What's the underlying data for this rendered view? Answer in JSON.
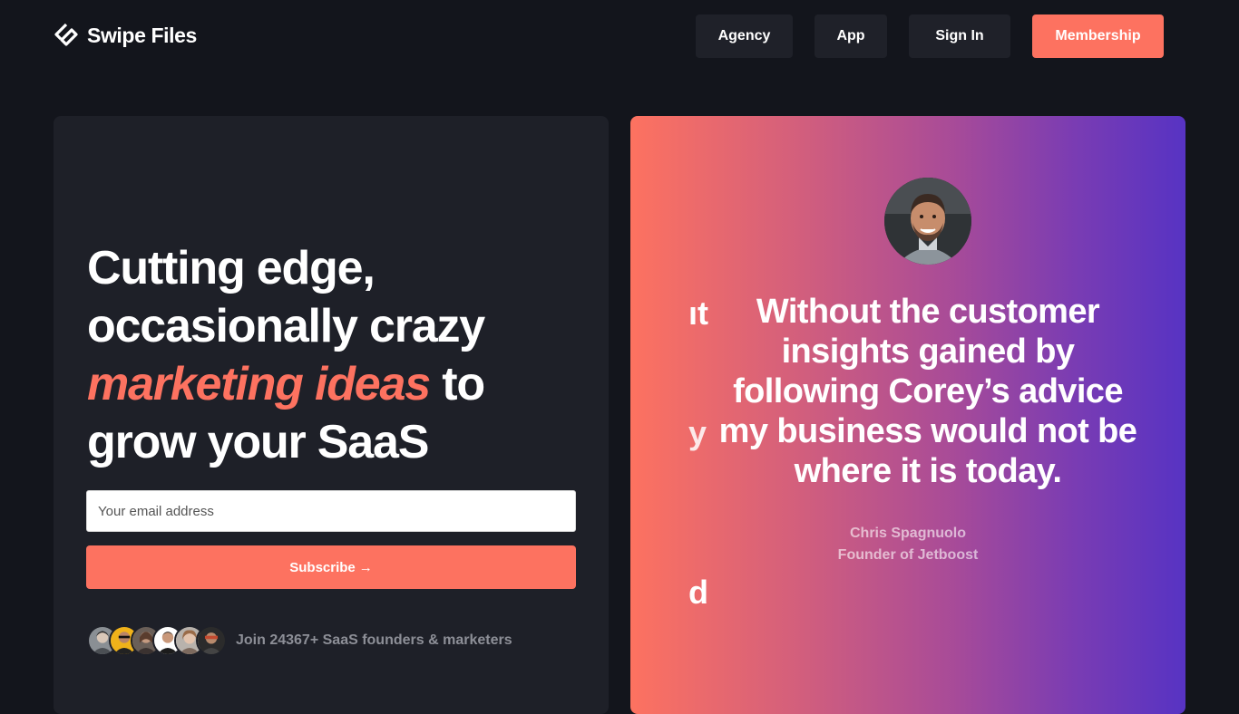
{
  "brand": {
    "name": "Swipe Files",
    "logo_icon": "swipe-files-logo-icon",
    "accent_color": "#fd7260"
  },
  "nav": {
    "items": [
      {
        "label": "Agency"
      },
      {
        "label": "App"
      },
      {
        "label": "Sign In"
      },
      {
        "label": "Membership"
      }
    ]
  },
  "hero": {
    "headline_line1": "Cutting edge,",
    "headline_line2": "occasionally crazy",
    "headline_accent": "marketing ideas",
    "headline_after_accent": " to",
    "headline_line4": "grow your SaaS",
    "email_placeholder": "Your email address",
    "subscribe_label": "Subscribe",
    "subscribe_icon": "arrow-right-icon",
    "subscribe_arrow": "→",
    "join_text": "Join 24367+ SaaS founders & marketers",
    "avatar_count": 6
  },
  "testimonial": {
    "quote": "Without the customer insights gained by following Corey’s advice my business would not be where it is today.",
    "author_name": "Chris Spagnuolo",
    "author_title": "Founder of Jetboost",
    "ghost_chars": [
      "ıt",
      "y",
      "d"
    ],
    "gradient_start": "#fd7260",
    "gradient_end": "#5733c3"
  }
}
